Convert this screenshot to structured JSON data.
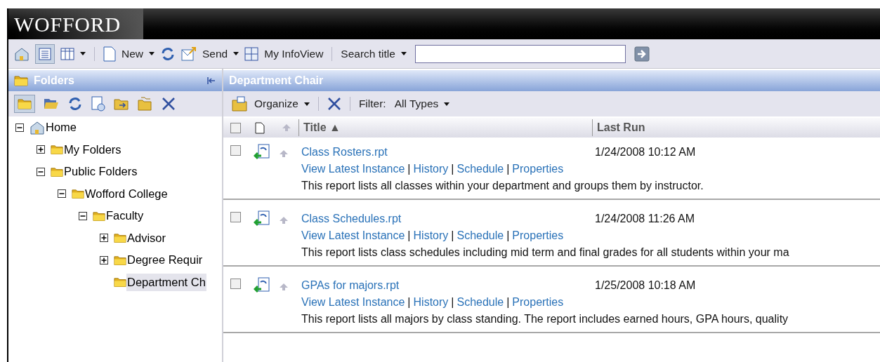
{
  "header": {
    "logo": "WOFFORD"
  },
  "toolbar": {
    "view_selected": true,
    "new_label": "New",
    "send_label": "Send",
    "infoview_label": "My InfoView",
    "search_label": "Search title"
  },
  "folders_panel": {
    "title": "Folders",
    "tree": [
      {
        "label": "Home",
        "kind": "home",
        "expandable": true,
        "expanded": true,
        "selected": false,
        "children": [
          {
            "label": "My Folders",
            "kind": "folder",
            "expandable": true,
            "expanded": false,
            "selected": false
          },
          {
            "label": "Public Folders",
            "kind": "folder",
            "expandable": true,
            "expanded": true,
            "selected": false,
            "children": [
              {
                "label": "Wofford College",
                "kind": "folder",
                "expandable": true,
                "expanded": true,
                "selected": false,
                "children": [
                  {
                    "label": "Faculty",
                    "kind": "folder",
                    "expandable": true,
                    "expanded": true,
                    "selected": false,
                    "children": [
                      {
                        "label": "Advisor",
                        "kind": "folder",
                        "expandable": true,
                        "expanded": false,
                        "selected": false
                      },
                      {
                        "label": "Degree Requir",
                        "kind": "folder",
                        "expandable": true,
                        "expanded": false,
                        "selected": false
                      },
                      {
                        "label": "Department Ch",
                        "kind": "folder",
                        "expandable": false,
                        "selected": true
                      }
                    ]
                  }
                ]
              }
            ]
          }
        ]
      }
    ]
  },
  "content": {
    "title": "Department Chair",
    "organize_label": "Organize",
    "filter_label": "Filter:",
    "filter_value": "All Types",
    "select_all_checked": false,
    "columns": [
      "Title ▲",
      "Last Run"
    ],
    "rows": [
      {
        "checked": false,
        "title": "Class Rosters.rpt",
        "last_run": "1/24/2008 10:12 AM",
        "links": [
          "View Latest Instance",
          "History",
          "Schedule",
          "Properties"
        ],
        "separator": "|",
        "description": "This report lists all classes within your department and groups them by instructor."
      },
      {
        "checked": false,
        "title": "Class Schedules.rpt",
        "last_run": "1/24/2008 11:26 AM",
        "links": [
          "View Latest Instance",
          "History",
          "Schedule",
          "Properties"
        ],
        "separator": "|",
        "description": "This report lists class schedules including mid term and final grades for all students within your ma"
      },
      {
        "checked": false,
        "title": "GPAs for majors.rpt",
        "last_run": "1/25/2008 10:18 AM",
        "links": [
          "View Latest Instance",
          "History",
          "Schedule",
          "Properties"
        ],
        "separator": "|",
        "description": "This report lists all majors by class standing. The report includes earned hours, GPA hours, quality"
      }
    ]
  }
}
